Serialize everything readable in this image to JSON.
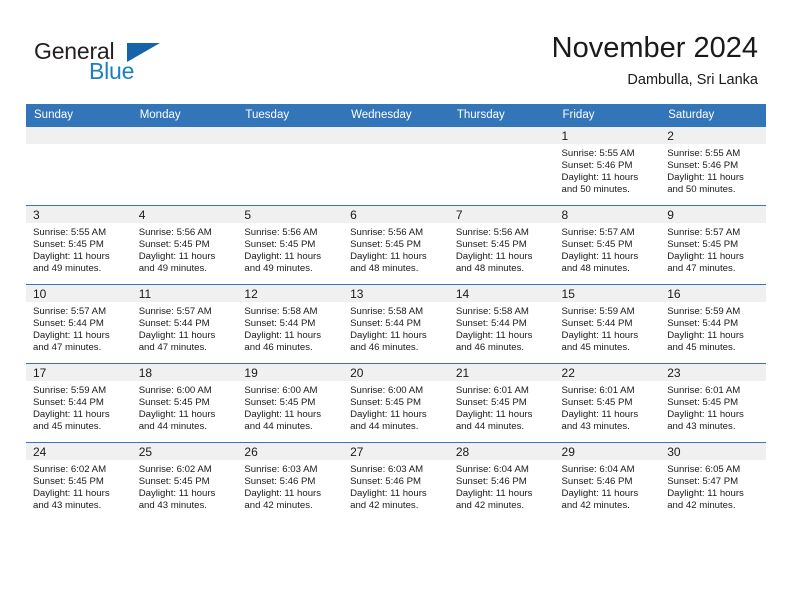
{
  "brand": {
    "name_part1": "General",
    "name_part2": "Blue",
    "triangle_color": "#1763a8",
    "blue_color": "#1b7fc4"
  },
  "header": {
    "title": "November 2024",
    "subtitle": "Dambulla, Sri Lanka"
  },
  "theme": {
    "header_row_bg": "#3275b8",
    "daynum_band_bg": "#f0f0f0",
    "cell_bg": "#ffffff",
    "text_color": "#1a1a1a"
  },
  "weekday_headers": [
    "Sunday",
    "Monday",
    "Tuesday",
    "Wednesday",
    "Thursday",
    "Friday",
    "Saturday"
  ],
  "labels": {
    "sunrise_prefix": "Sunrise:",
    "sunset_prefix": "Sunset:",
    "daylight_prefix": "Daylight:"
  },
  "weeks": [
    [
      {
        "day": "",
        "empty": true,
        "line1": "",
        "line2": "",
        "line3": "",
        "line4": ""
      },
      {
        "day": "",
        "empty": true,
        "line1": "",
        "line2": "",
        "line3": "",
        "line4": ""
      },
      {
        "day": "",
        "empty": true,
        "line1": "",
        "line2": "",
        "line3": "",
        "line4": ""
      },
      {
        "day": "",
        "empty": true,
        "line1": "",
        "line2": "",
        "line3": "",
        "line4": ""
      },
      {
        "day": "",
        "empty": true,
        "line1": "",
        "line2": "",
        "line3": "",
        "line4": ""
      },
      {
        "day": "1",
        "empty": false,
        "line1": "Sunrise: 5:55 AM",
        "line2": "Sunset: 5:46 PM",
        "line3": "Daylight: 11 hours",
        "line4": "and 50 minutes."
      },
      {
        "day": "2",
        "empty": false,
        "line1": "Sunrise: 5:55 AM",
        "line2": "Sunset: 5:46 PM",
        "line3": "Daylight: 11 hours",
        "line4": "and 50 minutes."
      }
    ],
    [
      {
        "day": "3",
        "empty": false,
        "line1": "Sunrise: 5:55 AM",
        "line2": "Sunset: 5:45 PM",
        "line3": "Daylight: 11 hours",
        "line4": "and 49 minutes."
      },
      {
        "day": "4",
        "empty": false,
        "line1": "Sunrise: 5:56 AM",
        "line2": "Sunset: 5:45 PM",
        "line3": "Daylight: 11 hours",
        "line4": "and 49 minutes."
      },
      {
        "day": "5",
        "empty": false,
        "line1": "Sunrise: 5:56 AM",
        "line2": "Sunset: 5:45 PM",
        "line3": "Daylight: 11 hours",
        "line4": "and 49 minutes."
      },
      {
        "day": "6",
        "empty": false,
        "line1": "Sunrise: 5:56 AM",
        "line2": "Sunset: 5:45 PM",
        "line3": "Daylight: 11 hours",
        "line4": "and 48 minutes."
      },
      {
        "day": "7",
        "empty": false,
        "line1": "Sunrise: 5:56 AM",
        "line2": "Sunset: 5:45 PM",
        "line3": "Daylight: 11 hours",
        "line4": "and 48 minutes."
      },
      {
        "day": "8",
        "empty": false,
        "line1": "Sunrise: 5:57 AM",
        "line2": "Sunset: 5:45 PM",
        "line3": "Daylight: 11 hours",
        "line4": "and 48 minutes."
      },
      {
        "day": "9",
        "empty": false,
        "line1": "Sunrise: 5:57 AM",
        "line2": "Sunset: 5:45 PM",
        "line3": "Daylight: 11 hours",
        "line4": "and 47 minutes."
      }
    ],
    [
      {
        "day": "10",
        "empty": false,
        "line1": "Sunrise: 5:57 AM",
        "line2": "Sunset: 5:44 PM",
        "line3": "Daylight: 11 hours",
        "line4": "and 47 minutes."
      },
      {
        "day": "11",
        "empty": false,
        "line1": "Sunrise: 5:57 AM",
        "line2": "Sunset: 5:44 PM",
        "line3": "Daylight: 11 hours",
        "line4": "and 47 minutes."
      },
      {
        "day": "12",
        "empty": false,
        "line1": "Sunrise: 5:58 AM",
        "line2": "Sunset: 5:44 PM",
        "line3": "Daylight: 11 hours",
        "line4": "and 46 minutes."
      },
      {
        "day": "13",
        "empty": false,
        "line1": "Sunrise: 5:58 AM",
        "line2": "Sunset: 5:44 PM",
        "line3": "Daylight: 11 hours",
        "line4": "and 46 minutes."
      },
      {
        "day": "14",
        "empty": false,
        "line1": "Sunrise: 5:58 AM",
        "line2": "Sunset: 5:44 PM",
        "line3": "Daylight: 11 hours",
        "line4": "and 46 minutes."
      },
      {
        "day": "15",
        "empty": false,
        "line1": "Sunrise: 5:59 AM",
        "line2": "Sunset: 5:44 PM",
        "line3": "Daylight: 11 hours",
        "line4": "and 45 minutes."
      },
      {
        "day": "16",
        "empty": false,
        "line1": "Sunrise: 5:59 AM",
        "line2": "Sunset: 5:44 PM",
        "line3": "Daylight: 11 hours",
        "line4": "and 45 minutes."
      }
    ],
    [
      {
        "day": "17",
        "empty": false,
        "line1": "Sunrise: 5:59 AM",
        "line2": "Sunset: 5:44 PM",
        "line3": "Daylight: 11 hours",
        "line4": "and 45 minutes."
      },
      {
        "day": "18",
        "empty": false,
        "line1": "Sunrise: 6:00 AM",
        "line2": "Sunset: 5:45 PM",
        "line3": "Daylight: 11 hours",
        "line4": "and 44 minutes."
      },
      {
        "day": "19",
        "empty": false,
        "line1": "Sunrise: 6:00 AM",
        "line2": "Sunset: 5:45 PM",
        "line3": "Daylight: 11 hours",
        "line4": "and 44 minutes."
      },
      {
        "day": "20",
        "empty": false,
        "line1": "Sunrise: 6:00 AM",
        "line2": "Sunset: 5:45 PM",
        "line3": "Daylight: 11 hours",
        "line4": "and 44 minutes."
      },
      {
        "day": "21",
        "empty": false,
        "line1": "Sunrise: 6:01 AM",
        "line2": "Sunset: 5:45 PM",
        "line3": "Daylight: 11 hours",
        "line4": "and 44 minutes."
      },
      {
        "day": "22",
        "empty": false,
        "line1": "Sunrise: 6:01 AM",
        "line2": "Sunset: 5:45 PM",
        "line3": "Daylight: 11 hours",
        "line4": "and 43 minutes."
      },
      {
        "day": "23",
        "empty": false,
        "line1": "Sunrise: 6:01 AM",
        "line2": "Sunset: 5:45 PM",
        "line3": "Daylight: 11 hours",
        "line4": "and 43 minutes."
      }
    ],
    [
      {
        "day": "24",
        "empty": false,
        "line1": "Sunrise: 6:02 AM",
        "line2": "Sunset: 5:45 PM",
        "line3": "Daylight: 11 hours",
        "line4": "and 43 minutes."
      },
      {
        "day": "25",
        "empty": false,
        "line1": "Sunrise: 6:02 AM",
        "line2": "Sunset: 5:45 PM",
        "line3": "Daylight: 11 hours",
        "line4": "and 43 minutes."
      },
      {
        "day": "26",
        "empty": false,
        "line1": "Sunrise: 6:03 AM",
        "line2": "Sunset: 5:46 PM",
        "line3": "Daylight: 11 hours",
        "line4": "and 42 minutes."
      },
      {
        "day": "27",
        "empty": false,
        "line1": "Sunrise: 6:03 AM",
        "line2": "Sunset: 5:46 PM",
        "line3": "Daylight: 11 hours",
        "line4": "and 42 minutes."
      },
      {
        "day": "28",
        "empty": false,
        "line1": "Sunrise: 6:04 AM",
        "line2": "Sunset: 5:46 PM",
        "line3": "Daylight: 11 hours",
        "line4": "and 42 minutes."
      },
      {
        "day": "29",
        "empty": false,
        "line1": "Sunrise: 6:04 AM",
        "line2": "Sunset: 5:46 PM",
        "line3": "Daylight: 11 hours",
        "line4": "and 42 minutes."
      },
      {
        "day": "30",
        "empty": false,
        "line1": "Sunrise: 6:05 AM",
        "line2": "Sunset: 5:47 PM",
        "line3": "Daylight: 11 hours",
        "line4": "and 42 minutes."
      }
    ]
  ]
}
